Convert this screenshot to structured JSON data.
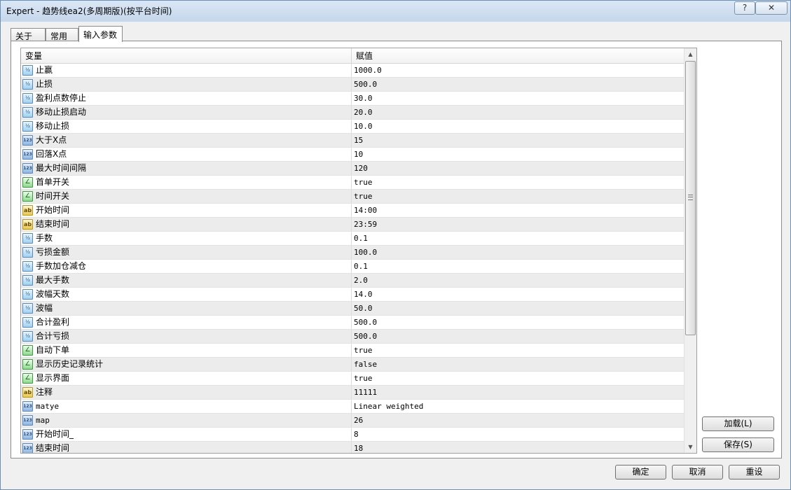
{
  "window": {
    "title": "Expert - 趋势线ea2(多周期版)(按平台时间)",
    "help_label": "?",
    "close_label": "✕"
  },
  "tabs": [
    {
      "label": "关于",
      "active": false
    },
    {
      "label": "常用",
      "active": false
    },
    {
      "label": "输入参数",
      "active": true
    }
  ],
  "grid": {
    "columns": {
      "variable": "变量",
      "value": "赋值"
    },
    "type_icons": {
      "double": "½",
      "int": "123",
      "bool": "∠",
      "string": "ab"
    },
    "rows": [
      {
        "type": "double",
        "name": "止赢",
        "value": "1000.0"
      },
      {
        "type": "double",
        "name": "止损",
        "value": "500.0"
      },
      {
        "type": "double",
        "name": "盈利点数停止",
        "value": "30.0"
      },
      {
        "type": "double",
        "name": "移动止损启动",
        "value": "20.0"
      },
      {
        "type": "double",
        "name": "移动止损",
        "value": "10.0"
      },
      {
        "type": "int",
        "name": "大于X点",
        "value": "15"
      },
      {
        "type": "int",
        "name": "回落X点",
        "value": "10"
      },
      {
        "type": "int",
        "name": "最大时间间隔",
        "value": "120"
      },
      {
        "type": "bool",
        "name": "首单开关",
        "value": "true"
      },
      {
        "type": "bool",
        "name": "时间开关",
        "value": "true"
      },
      {
        "type": "string",
        "name": "开始时间",
        "value": "14:00"
      },
      {
        "type": "string",
        "name": "结束时间",
        "value": "23:59"
      },
      {
        "type": "double",
        "name": "手数",
        "value": "0.1"
      },
      {
        "type": "double",
        "name": "亏损金额",
        "value": "100.0"
      },
      {
        "type": "double",
        "name": "手数加仓减仓",
        "value": "0.1"
      },
      {
        "type": "double",
        "name": "最大手数",
        "value": "2.0"
      },
      {
        "type": "double",
        "name": "波幅天数",
        "value": "14.0"
      },
      {
        "type": "double",
        "name": "波幅",
        "value": "50.0"
      },
      {
        "type": "double",
        "name": "合计盈利",
        "value": "500.0"
      },
      {
        "type": "double",
        "name": "合计亏损",
        "value": "500.0"
      },
      {
        "type": "bool",
        "name": "自动下单",
        "value": "true"
      },
      {
        "type": "bool",
        "name": "显示历史记录统计",
        "value": "false"
      },
      {
        "type": "bool",
        "name": "显示界面",
        "value": "true"
      },
      {
        "type": "string",
        "name": "注释",
        "value": "11111"
      },
      {
        "type": "int",
        "name": "matye",
        "value": "Linear weighted"
      },
      {
        "type": "int",
        "name": "map",
        "value": "26"
      },
      {
        "type": "int",
        "name": "开始时间_",
        "value": "8"
      },
      {
        "type": "int",
        "name": "结束时间",
        "value": "18"
      }
    ]
  },
  "buttons": {
    "load": "加载(L)",
    "save": "保存(S)",
    "ok": "确定",
    "cancel": "取消",
    "reset": "重设"
  }
}
